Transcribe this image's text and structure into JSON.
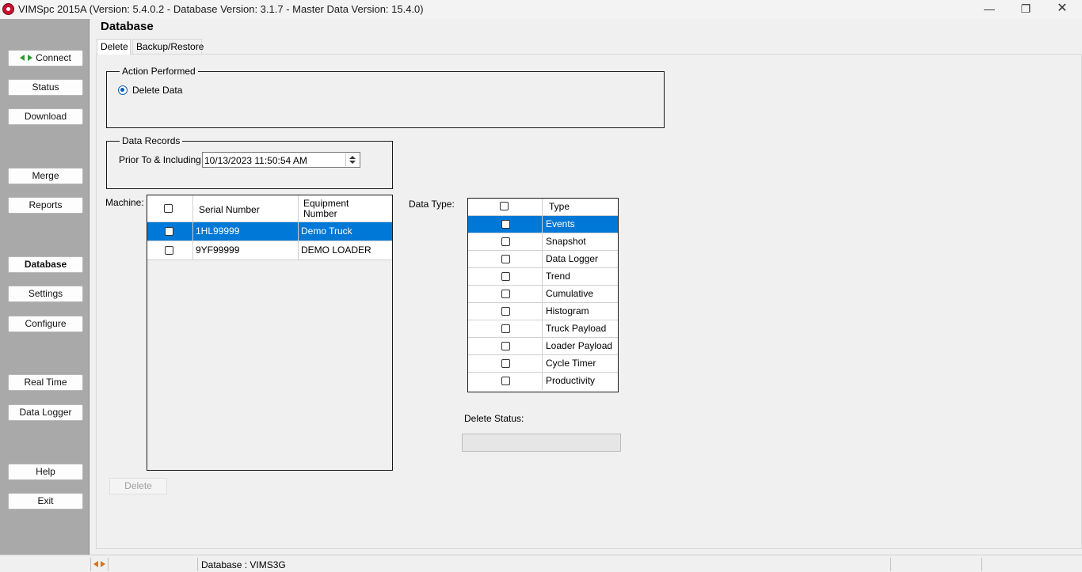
{
  "window": {
    "title": "VIMSpc 2015A (Version: 5.4.0.2 - Database Version: 3.1.7 - Master Data Version: 15.4.0)",
    "minimize": "—",
    "maximize": "❐",
    "close": "✕"
  },
  "sidebar": {
    "items": [
      {
        "label": "Connect"
      },
      {
        "label": "Status"
      },
      {
        "label": "Download"
      },
      {
        "label": "Merge"
      },
      {
        "label": "Reports"
      },
      {
        "label": "Database",
        "active": true
      },
      {
        "label": "Settings"
      },
      {
        "label": "Configure"
      },
      {
        "label": "Real Time"
      },
      {
        "label": "Data Logger"
      },
      {
        "label": "Help"
      },
      {
        "label": "Exit"
      }
    ]
  },
  "page": {
    "title": "Database",
    "tabs": [
      {
        "label": "Delete",
        "active": true
      },
      {
        "label": "Backup/Restore"
      }
    ]
  },
  "action_performed": {
    "legend": "Action Performed",
    "option": "Delete Data",
    "selected": true
  },
  "data_records": {
    "legend": "Data Records",
    "label": "Prior To & Including:",
    "date_value": "10/13/2023 11:50:54 AM"
  },
  "machine": {
    "label": "Machine:",
    "columns": [
      "Serial Number",
      "Equipment Number"
    ],
    "rows": [
      {
        "serial": "1HL99999",
        "equipment": "Demo Truck",
        "selected": true,
        "checked": false
      },
      {
        "serial": "9YF99999",
        "equipment": "DEMO LOADER",
        "selected": false,
        "checked": false
      }
    ]
  },
  "data_type": {
    "label": "Data Type:",
    "column": "Type",
    "rows": [
      {
        "name": "Events",
        "selected": true
      },
      {
        "name": "Snapshot"
      },
      {
        "name": "Data Logger"
      },
      {
        "name": "Trend"
      },
      {
        "name": "Cumulative"
      },
      {
        "name": "Histogram"
      },
      {
        "name": "Truck Payload"
      },
      {
        "name": "Loader Payload"
      },
      {
        "name": "Cycle Timer"
      },
      {
        "name": "Productivity"
      }
    ]
  },
  "delete_status": {
    "label": "Delete Status:",
    "value": ""
  },
  "delete_button": {
    "label": "Delete"
  },
  "status_bar": {
    "database": "Database : VIMS3G"
  },
  "colors": {
    "selection": "#0078d7",
    "sidebar": "#a9a9a9",
    "accent_radio": "#0f5eb5"
  }
}
